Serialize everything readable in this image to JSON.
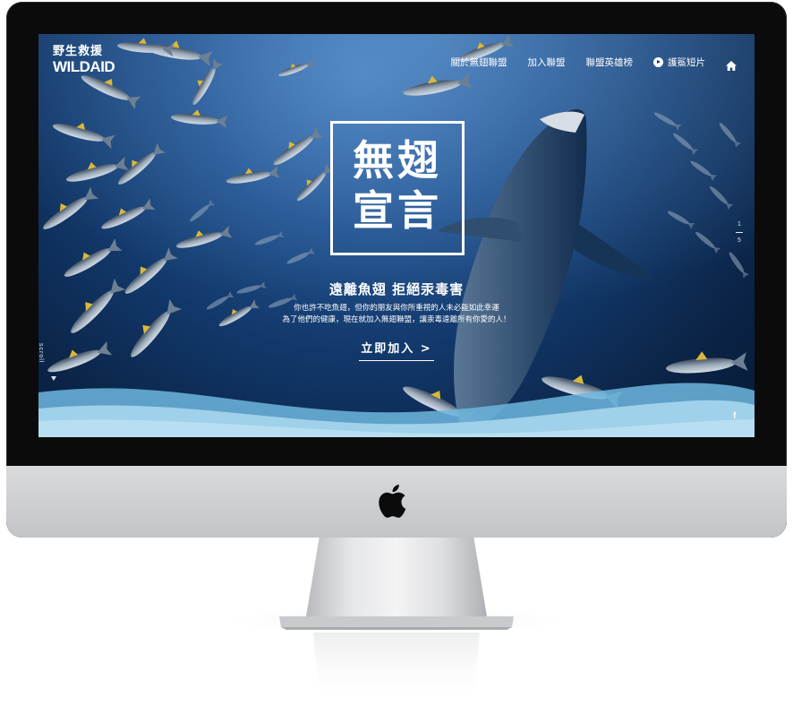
{
  "site": {
    "logo": {
      "chinese": "野生救援",
      "english": "WILDAID"
    },
    "nav": {
      "items": [
        {
          "label": "關於無翅聯盟"
        },
        {
          "label": "加入聯盟"
        },
        {
          "label": "聯盟英雄榜"
        },
        {
          "label": "護鯊短片",
          "icon": "play-icon"
        }
      ],
      "home_icon": "home-icon"
    },
    "hero": {
      "title_line1": "無翅",
      "title_line2": "宣言",
      "tagline": "遠離魚翅  拒絕汞毒害",
      "desc_line1": "你也許不吃魚翅，但你的朋友與你所重視的人未必能如此幸運",
      "desc_line2": "為了他們的健康，現在就加入無翅聯盟，讓汞毒遠離所有你愛的人！",
      "cta": "立即加入 >"
    },
    "pager": {
      "current": "1",
      "total": "5"
    },
    "scroll_label": "scroll",
    "social_icon": "f"
  },
  "colors": {
    "ocean_dark": "#0b2447",
    "ocean_mid": "#1f4f8c",
    "wave_light": "#9fd1ea",
    "wave_mid": "#6db6de",
    "bezel": "#0b0b0c",
    "aluminum": "#cfd0d3"
  }
}
